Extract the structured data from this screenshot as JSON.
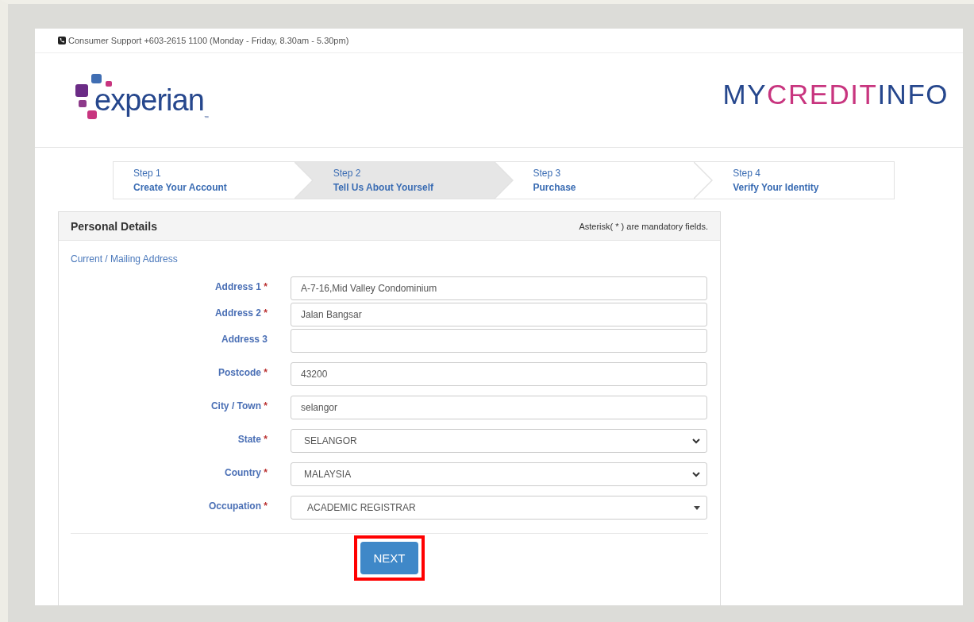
{
  "support_bar": {
    "text": "Consumer Support +603-2615 1100 (Monday - Friday, 8.30am - 5.30pm)"
  },
  "header": {
    "logo_text": "experian",
    "logo_mark": "™",
    "brand": [
      {
        "text": "MY",
        "color": "#26478d"
      },
      {
        "text": "CREDIT",
        "color": "#c8357f"
      },
      {
        "text": "INFO",
        "color": "#26478d"
      }
    ]
  },
  "steps": [
    {
      "number": "Step 1",
      "title": "Create Your Account",
      "selected": false
    },
    {
      "number": "Step 2",
      "title": "Tell Us About Yourself",
      "selected": true
    },
    {
      "number": "Step 3",
      "title": "Purchase",
      "selected": false
    },
    {
      "number": "Step 4",
      "title": "Verify Your Identity",
      "selected": false
    }
  ],
  "panel": {
    "title": "Personal Details",
    "note": "Asterisk( * ) are mandatory fields.",
    "section": "Current / Mailing Address",
    "address_fields": [
      {
        "label": "Address 1",
        "mark": "*",
        "kind": "text",
        "value": "A-7-16,Mid Valley Condominium"
      },
      {
        "label": "Address 2",
        "mark": "*",
        "kind": "text",
        "value": "Jalan Bangsar"
      },
      {
        "label": "Address 3",
        "kind": "text"
      }
    ],
    "fields": [
      {
        "label": "Postcode",
        "mark": "*",
        "kind": "text",
        "value": "43200"
      },
      {
        "label": "City / Town",
        "mark": "*",
        "kind": "text",
        "value": "selangor"
      },
      {
        "label": "State",
        "mark": "*",
        "kind": "select",
        "value": "SELANGOR"
      },
      {
        "label": "Country",
        "mark": "*",
        "kind": "select",
        "value": "MALAYSIA"
      },
      {
        "label": "Occupation",
        "mark": "*",
        "kind": "combo",
        "value": "ACADEMIC REGISTRAR"
      }
    ],
    "button": {
      "label": "NEXT",
      "highlighted": true
    }
  }
}
